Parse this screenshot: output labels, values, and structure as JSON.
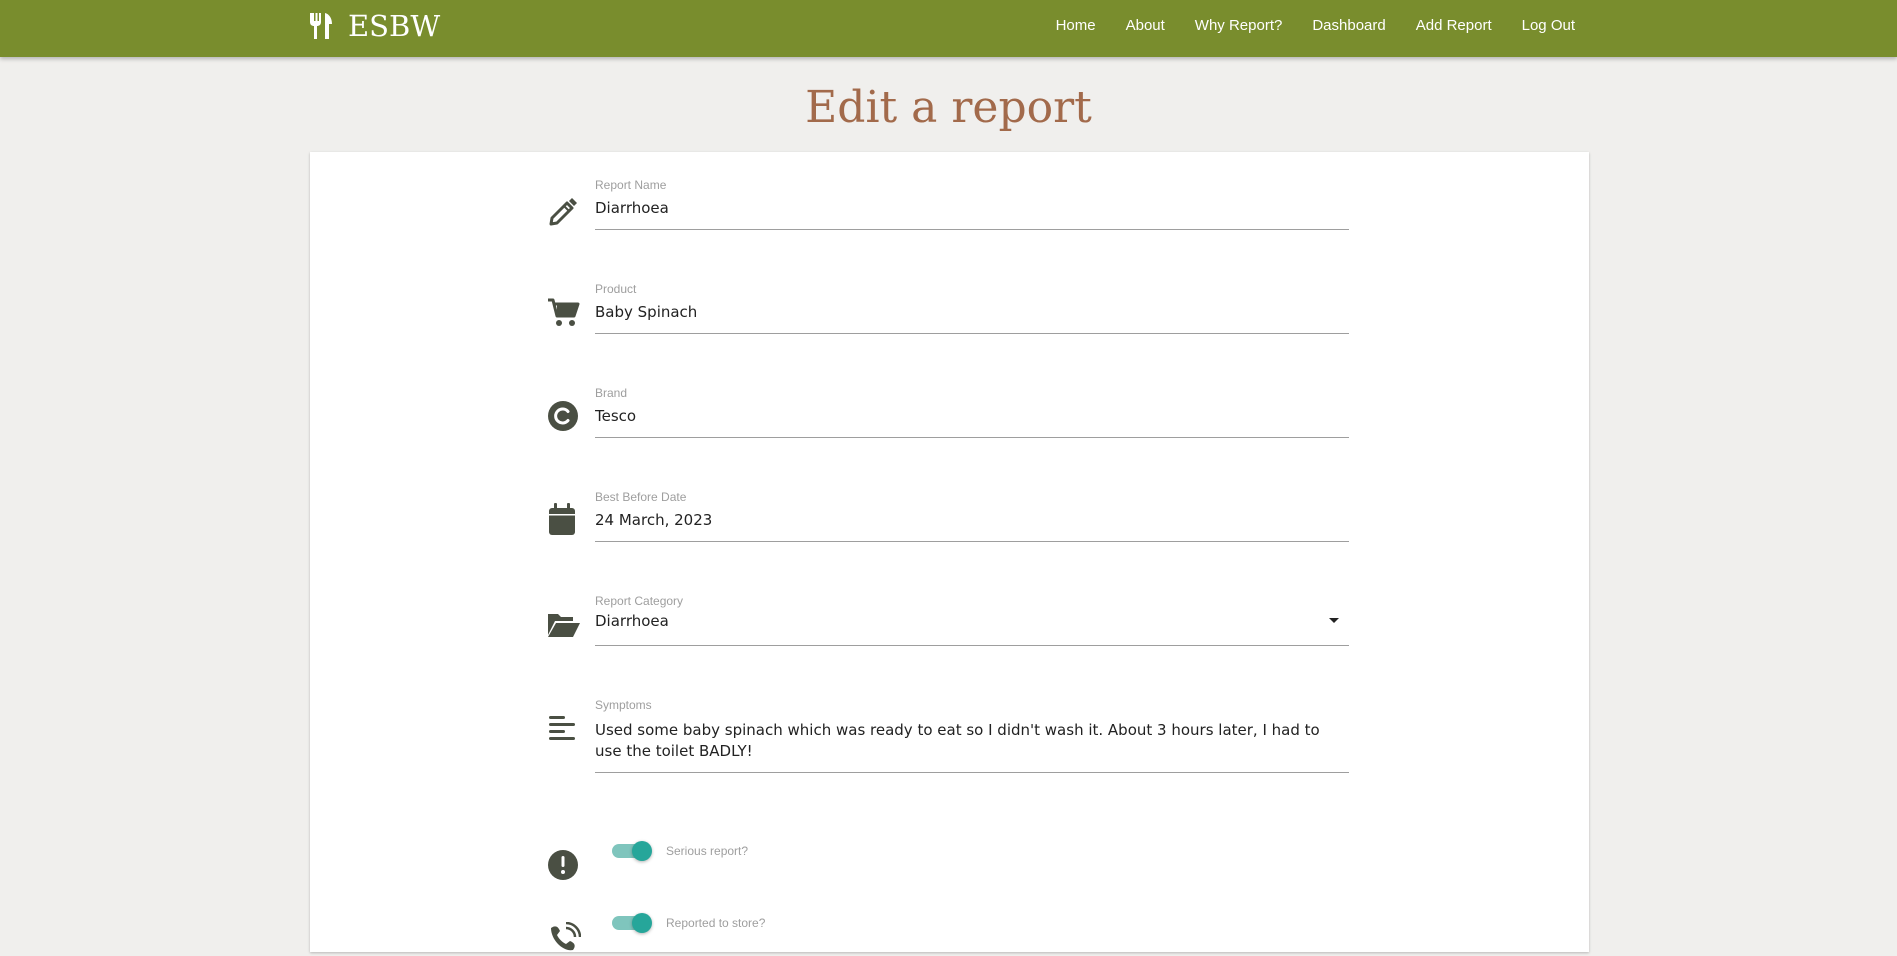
{
  "nav": {
    "brand": "ESBW",
    "brand_icon": "fork-knife-icon",
    "links": [
      "Home",
      "About",
      "Why Report?",
      "Dashboard",
      "Add Report",
      "Log Out"
    ]
  },
  "page": {
    "title": "Edit a report"
  },
  "form": {
    "report_name": {
      "label": "Report Name",
      "value": "Diarrhoea",
      "icon": "pencil-icon"
    },
    "product": {
      "label": "Product",
      "value": "Baby Spinach",
      "icon": "cart-icon"
    },
    "brand": {
      "label": "Brand",
      "value": "Tesco",
      "icon": "copyright-icon"
    },
    "best_before": {
      "label": "Best Before Date",
      "value": "24 March, 2023",
      "icon": "calendar-icon"
    },
    "category": {
      "label": "Report Category",
      "value": "Diarrhoea",
      "icon": "folder-open-icon"
    },
    "symptoms": {
      "label": "Symptoms",
      "value": "Used some baby spinach which was ready to eat so I didn't wash it. About 3 hours later, I had to use the toilet BADLY!",
      "icon": "align-left-icon"
    },
    "serious": {
      "label": "Serious report?",
      "checked": true,
      "icon": "exclamation-circle-icon"
    },
    "reported_store": {
      "label": "Reported to store?",
      "checked": true,
      "icon": "phone-volume-icon"
    }
  },
  "colors": {
    "navbar": "#798d2d",
    "title": "#a26a4b",
    "accent": "#26a69a",
    "icon": "#4a4f43"
  }
}
